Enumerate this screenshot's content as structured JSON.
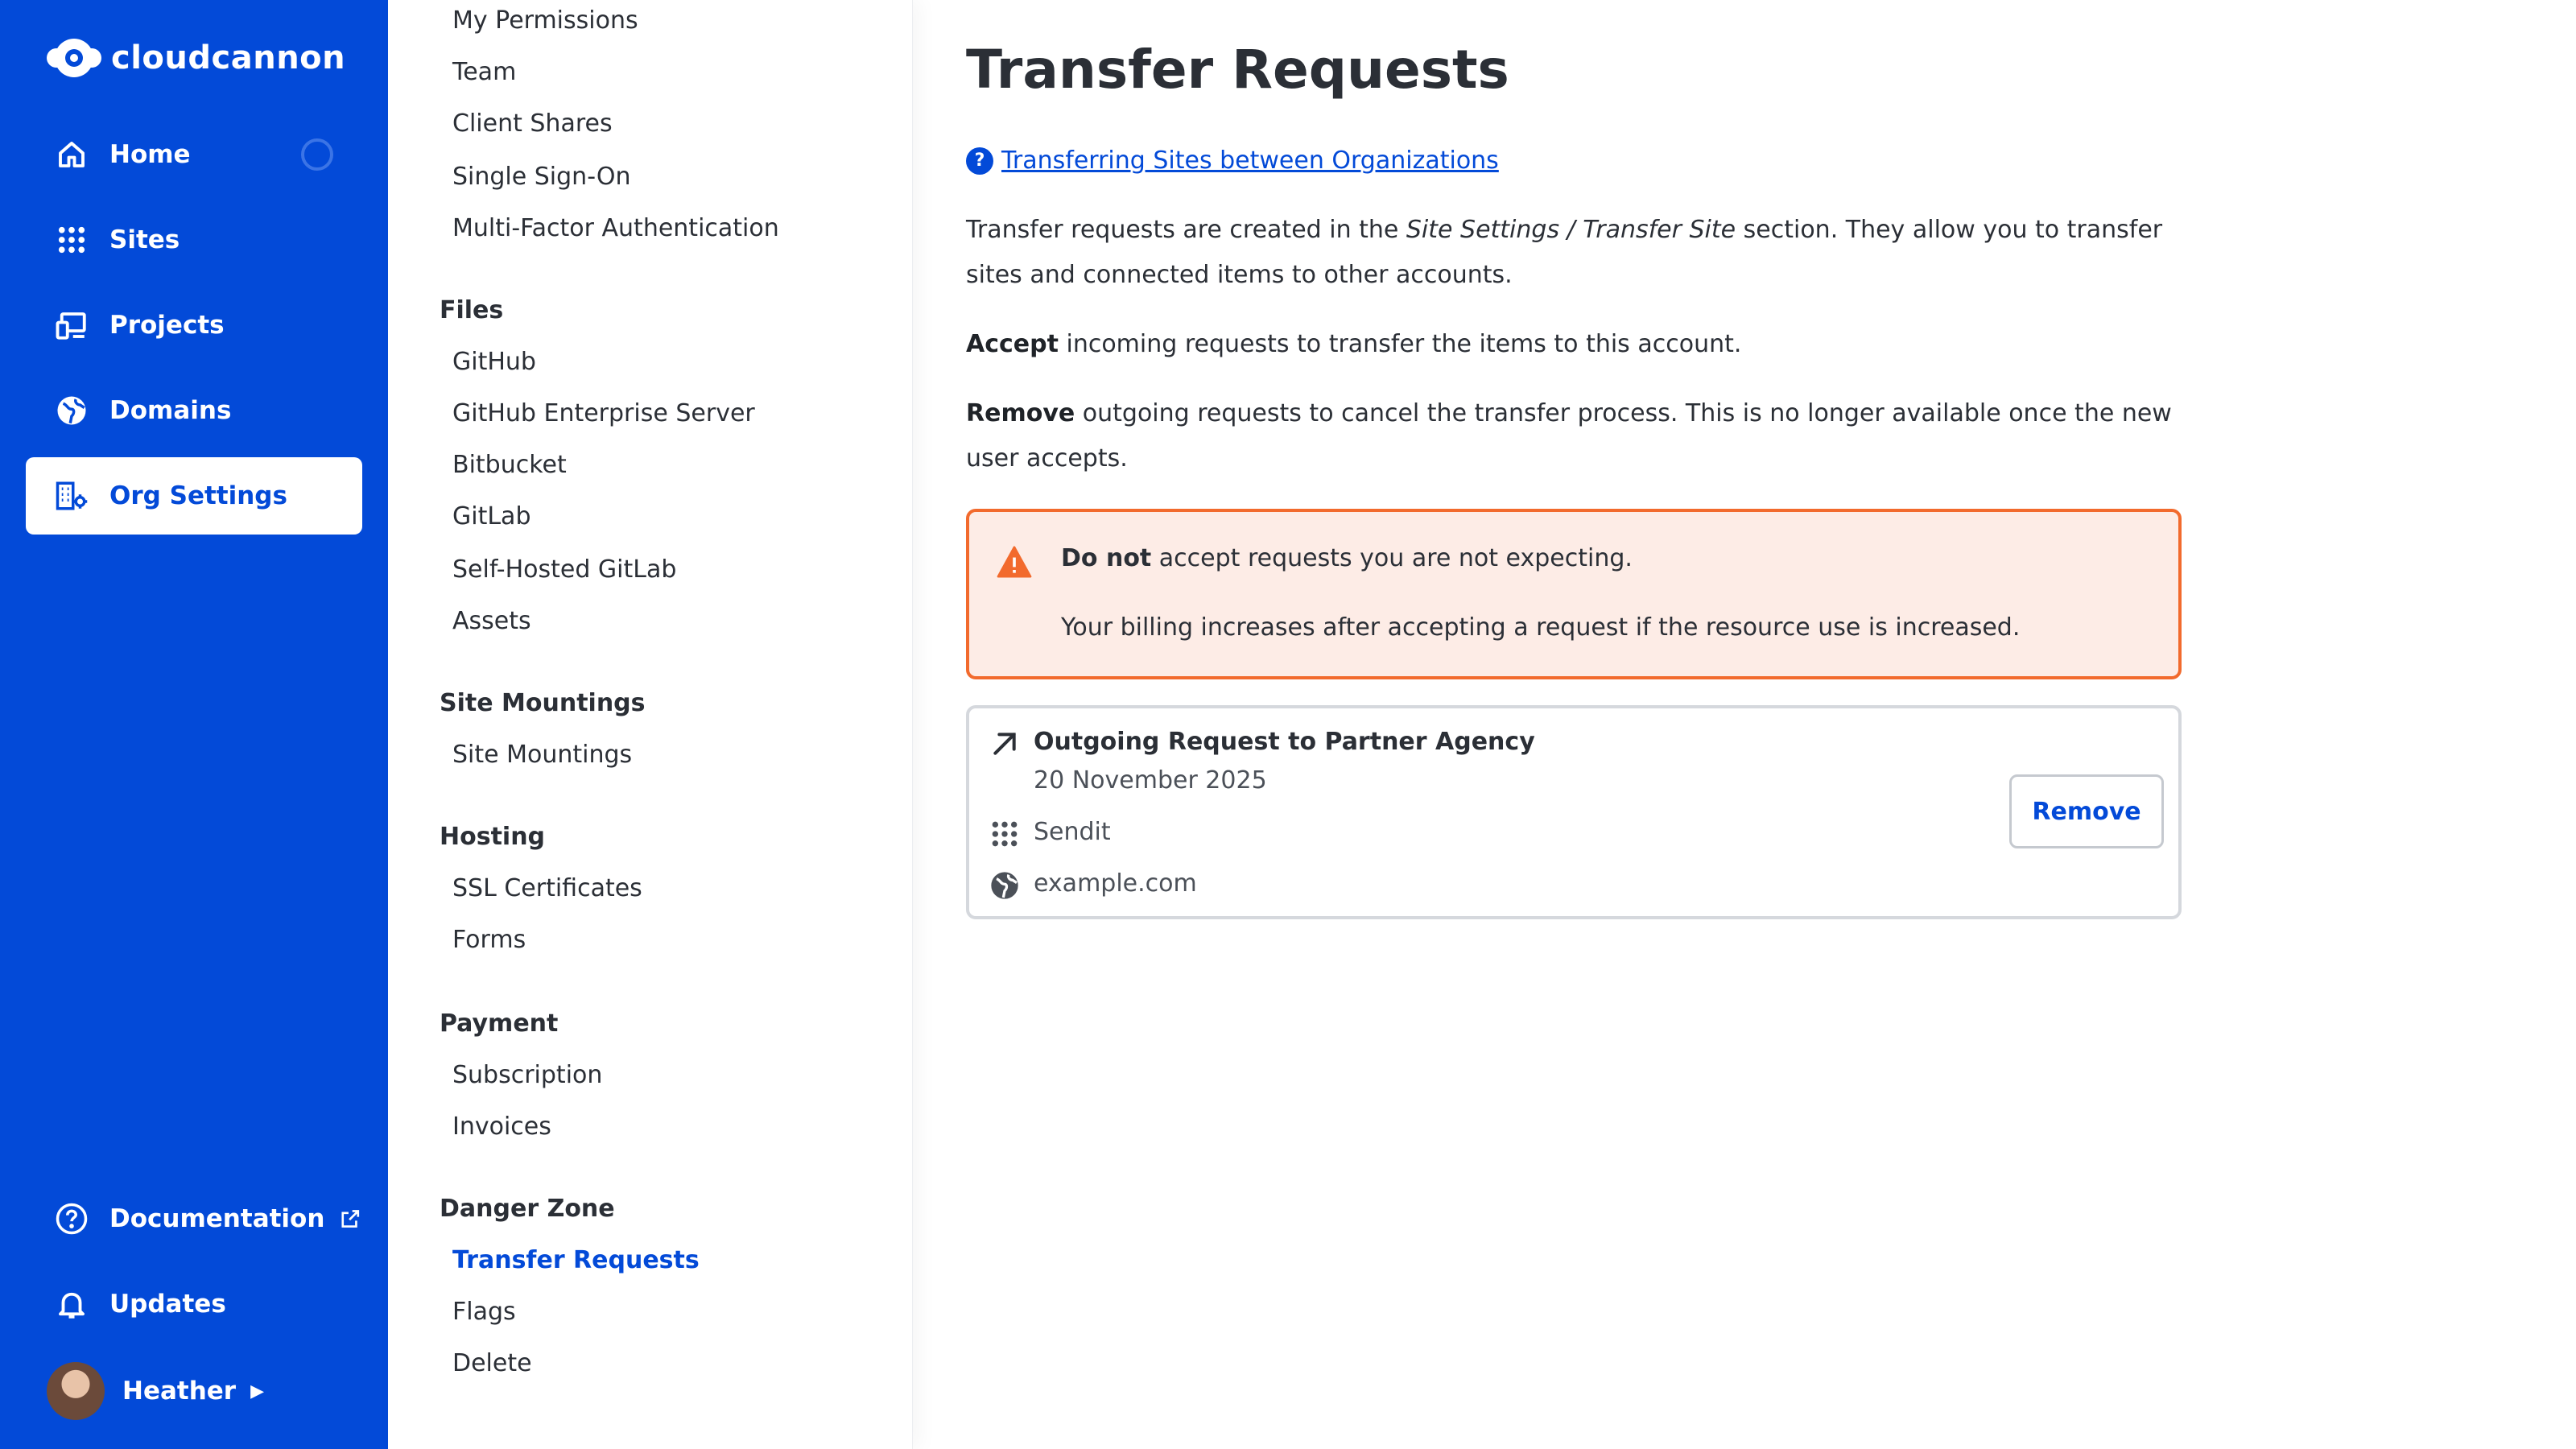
{
  "brand": {
    "name": "cloudcannon"
  },
  "nav": {
    "home": "Home",
    "sites": "Sites",
    "projects": "Projects",
    "domains": "Domains",
    "org_settings": "Org Settings",
    "documentation": "Documentation",
    "updates": "Updates",
    "user": "Heather"
  },
  "submenu": {
    "links_top": [
      "My Permissions",
      "Team",
      "Client Shares",
      "Single Sign-On",
      "Multi-Factor Authentication"
    ],
    "files": {
      "heading": "Files",
      "links": [
        "GitHub",
        "GitHub Enterprise Server",
        "Bitbucket",
        "GitLab",
        "Self-Hosted GitLab",
        "Assets"
      ]
    },
    "site_mountings": {
      "heading": "Site Mountings",
      "links": [
        "Site Mountings"
      ]
    },
    "hosting": {
      "heading": "Hosting",
      "links": [
        "SSL Certificates",
        "Forms"
      ]
    },
    "payment": {
      "heading": "Payment",
      "links": [
        "Subscription",
        "Invoices"
      ]
    },
    "danger_zone": {
      "heading": "Danger Zone",
      "links": [
        "Transfer Requests",
        "Flags",
        "Delete"
      ]
    }
  },
  "main": {
    "title": "Transfer Requests",
    "help_link": "Transferring Sites between Organizations",
    "intro": {
      "part1": "Transfer requests are created in the ",
      "site_settings": "Site Settings",
      "slash": " / ",
      "transfer_site": "Transfer Site",
      "part2": " section. They allow you to transfer sites and connected items to other accounts."
    },
    "accept": {
      "bold": "Accept",
      "rest": " incoming requests to transfer the items to this account."
    },
    "remove": {
      "bold": "Remove",
      "rest": " outgoing requests to cancel the transfer process. This is no longer available once the new user accepts."
    },
    "warning": {
      "bold": "Do not",
      "line1_rest": " accept requests you are not expecting.",
      "line2": "Your billing increases after accepting a request if the resource use is increased."
    },
    "request": {
      "title": "Outgoing Request to Partner Agency",
      "date": "20 November 2025",
      "site": "Sendit",
      "domain": "example.com",
      "remove_label": "Remove"
    }
  },
  "colors": {
    "nav_bg": "#034ad8",
    "accent": "#034ad8",
    "warning_border": "#f26a2d",
    "warning_bg": "#fdece6"
  }
}
